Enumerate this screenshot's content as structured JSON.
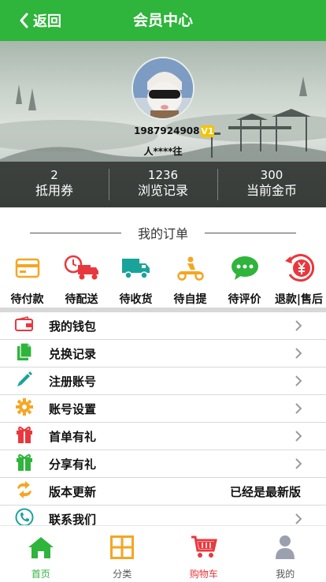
{
  "header": {
    "back_label": "返回",
    "title": "会员中心"
  },
  "profile": {
    "phone": "1987924908",
    "level": "V1",
    "nickname": "人****往"
  },
  "stats": [
    {
      "value": "2",
      "label": "抵用券"
    },
    {
      "value": "1236",
      "label": "浏览记录"
    },
    {
      "value": "300",
      "label": "当前金币"
    }
  ],
  "orders": {
    "heading": "我的订单",
    "items": [
      {
        "label": "待付款",
        "icon": "card-icon"
      },
      {
        "label": "待配送",
        "icon": "truck-clock-icon"
      },
      {
        "label": "待收货",
        "icon": "truck-icon"
      },
      {
        "label": "待自提",
        "icon": "scooter-icon"
      },
      {
        "label": "待评价",
        "icon": "chat-bubble-icon"
      },
      {
        "label": "退款|售后",
        "icon": "refund-icon"
      }
    ]
  },
  "menu": [
    {
      "label": "我的钱包",
      "icon": "wallet-icon",
      "value": ""
    },
    {
      "label": "兑换记录",
      "icon": "documents-icon",
      "value": ""
    },
    {
      "label": "注册账号",
      "icon": "pencil-icon",
      "value": ""
    },
    {
      "label": "账号设置",
      "icon": "gear-icon",
      "value": ""
    },
    {
      "label": "首单有礼",
      "icon": "gift-icon",
      "value": ""
    },
    {
      "label": "分享有礼",
      "icon": "gift-green-icon",
      "value": ""
    },
    {
      "label": "版本更新",
      "icon": "refresh-icon",
      "value": "已经是最新版"
    },
    {
      "label": "联系我们",
      "icon": "phone-icon",
      "value": ""
    }
  ],
  "tabbar": [
    {
      "label": "首页",
      "icon": "home-icon",
      "color": "#2fb43c"
    },
    {
      "label": "分类",
      "icon": "grid-icon",
      "color": "#555555"
    },
    {
      "label": "购物车",
      "icon": "cart-icon",
      "color": "#e8383d"
    },
    {
      "label": "我的",
      "icon": "user-icon",
      "color": "#555555"
    }
  ],
  "colors": {
    "brand": "#2fb43c",
    "accent_orange": "#f5a623",
    "accent_red": "#e8383d",
    "accent_teal": "#1aa39a"
  }
}
